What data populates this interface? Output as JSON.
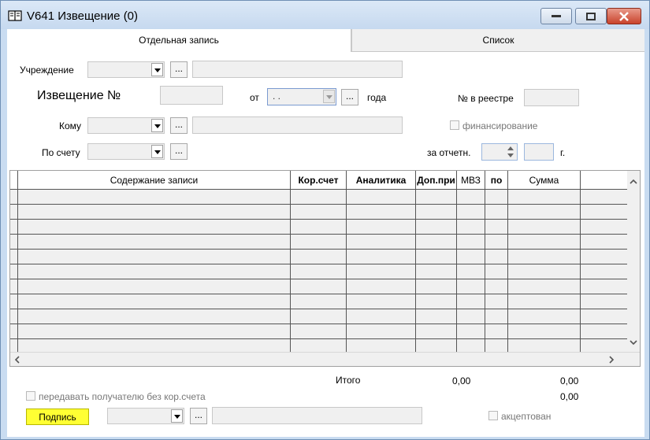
{
  "window": {
    "title": "V641 Извещение (0)",
    "icon": "book-icon"
  },
  "tabs": [
    {
      "label": "Отдельная запись",
      "active": true
    },
    {
      "label": "Список",
      "active": false
    }
  ],
  "form": {
    "institution_label": "Учреждение",
    "notice_label": "Извещение №",
    "from_label": "от",
    "date_value": ". .",
    "year_label": "года",
    "registry_label": "№ в реестре",
    "to_label": "Кому",
    "financing_label": "финансирование",
    "account_label": "По счету",
    "period_label": "за отчетн.",
    "g_label": "г.",
    "ellipsis": "..."
  },
  "grid": {
    "columns": [
      "Содержание записи",
      "Кор.счет",
      "Аналитика",
      "Доп.при",
      "МВЗ",
      "по",
      "Сумма"
    ],
    "rows": [
      "",
      "",
      "",
      "",
      "",
      "",
      "",
      "",
      "",
      "",
      ""
    ]
  },
  "footer": {
    "total_label": "Итого",
    "total_1": "0,00",
    "total_2": "0,00",
    "total_3": "0,00",
    "send_without_label": "передавать получателю без кор.счета",
    "sign_button": "Подпись",
    "accepted_label": "акцептован"
  },
  "colors": {
    "sign_button_bg": "#ffff33",
    "title_bg": "#c9dcf1",
    "close_button": "#c9432c"
  }
}
